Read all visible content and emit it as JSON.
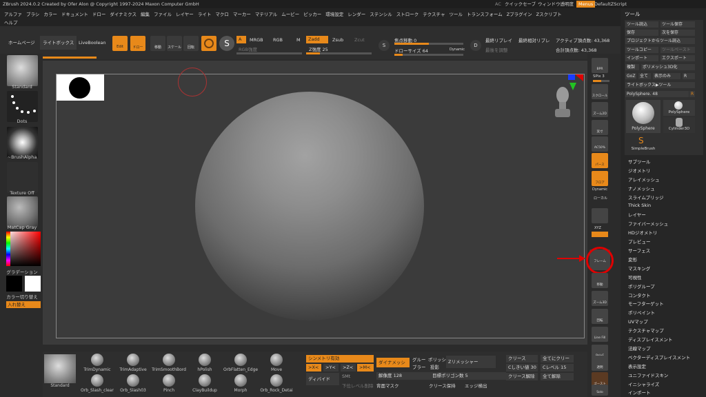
{
  "title": {
    "app": "ZBrush 2024.0.2  Created by Ofer Alon @ Copyright 1997-2024 Maxon Computer GmbH",
    "ac": "AC",
    "quicksave": "クイックセーブ",
    "window_transparency": "ウィンドウ透明度",
    "menus": "Menus",
    "script": "DefaultZScript"
  },
  "menubar": {
    "row1": [
      "アルファ",
      "ブラシ",
      "カラー",
      "ドキュメント",
      "ドロー",
      "ダイナミクス",
      "編集",
      "ファイル",
      "レイヤー",
      "ライト",
      "マクロ",
      "マーカー",
      "マテリアル",
      "ムービー",
      "ピッカー",
      "環境設定",
      "レンダー",
      "ステンシル",
      "ストローク",
      "テクスチャ",
      "ツール",
      "トランスフォーム",
      "Zプラグイン",
      "Zスクリプト"
    ],
    "row2": [
      "ヘルプ"
    ]
  },
  "tabs": {
    "home": "ホームページ",
    "lightbox": "ライトボックス",
    "liveboolean": "LiveBoolean"
  },
  "modes": {
    "edit": "Edit",
    "draw": "ドロー",
    "move": "移動",
    "scale": "スケール",
    "rotate": "回転"
  },
  "material_ops": {
    "a": "A",
    "mrgb": "MRGB",
    "rgb": "RGB",
    "m": "M",
    "rgb_intensity": "RGB強度"
  },
  "z_ops": {
    "zadd": "Zadd",
    "zsub": "Zsub",
    "zcut": "Zcut",
    "zintensity_label": "Z強度",
    "zintensity": "25"
  },
  "focal": {
    "label": "焦点移動",
    "value": "0",
    "drawsize_label": "ドローサイズ",
    "drawsize": "64",
    "dynamic": "Dynamic"
  },
  "replay": {
    "last": "最終リプレイ",
    "last_relative": "最終相対リプレ",
    "adjust": "最後を調整"
  },
  "points": {
    "active": "アクティブ頂点数: 43,368",
    "total": "合計頂点数: 43,368"
  },
  "left": {
    "brush": "Standard",
    "stroke": "Dots",
    "alpha": "~BrushAlpha",
    "texture": "Texture Off",
    "material": "MatCap Gray",
    "gradient": "グラデーション",
    "switch_color": "カラー切り替え",
    "swap": "入れ替え"
  },
  "right_shelf": {
    "bpr": "BPR",
    "spix_label": "SPix",
    "spix": "3",
    "scroll": "スクロール",
    "zoom2d": "ズーム2D",
    "actual": "実寸",
    "ac50": "AC50%",
    "perspective": "パース",
    "floor": "フロア",
    "dynamic": "Dynamic",
    "local": "ローカル",
    "xyz": "XYZ",
    "frame": "フレーム",
    "move": "移動",
    "zoom3d": "ズーム3D",
    "rotate": "回転",
    "linefill": "Line Fill",
    "polyf": "PolyF",
    "transp": "透明",
    "ghost": "ゴースト",
    "solo": "Solo"
  },
  "tool_panel": {
    "title": "ツール",
    "buttons": {
      "load": "ツール読込",
      "save_tool": "ツール保存",
      "save": "保存",
      "save_as": "次を保存",
      "load_from_project": "プロジェクトからツール読込",
      "copy": "ツールコピー",
      "paste": "ツールペースト",
      "import": "インポート",
      "export": "エクスポート",
      "clone": "複製",
      "make_polymesh": "ポリメッシュ3D化",
      "goz": "GoZ",
      "all": "全て",
      "visible": "表示のみ",
      "r": "R",
      "lightbox_tool": "ライトボックス▶ツール"
    },
    "current": "PolySphere. 48",
    "current_r": "R",
    "thumbs": {
      "polysphere": "PolySphere",
      "polysphere_small": "PolySphere",
      "cylinder": "Cylinder3D",
      "simplebrush": "SimpleBrush"
    },
    "subpalettes": [
      "サブツール",
      "ジオメトリ",
      "アレイメッシュ",
      "ナノメッシュ",
      "スライムブリッジ",
      "Thick Skin",
      "レイヤー",
      "ファイバーメッシュ",
      "HDジオメトリ",
      "プレビュー",
      "サーフェス",
      "変形",
      "マスキング",
      "可視性",
      "ポリグループ",
      "コンタクト",
      "モーフターゲット",
      "ポリペイント",
      "UVマップ",
      "テクスチャマップ",
      "ディスプレイスメント",
      "法線マップ",
      "ベクターディスプレイスメント",
      "表示設定",
      "ユニファイドスキン",
      "イニシャライズ",
      "インポート"
    ]
  },
  "bottom": {
    "brushes": [
      {
        "top": "TrimDynamic",
        "bottom": "Orb_Slash_clear"
      },
      {
        "top": "TrimAdaptive",
        "bottom": "Orb_Slash03"
      },
      {
        "top": "TrimSmoothBord",
        "bottom": "Pinch"
      },
      {
        "top": "hPolish",
        "bottom": "ClayBuildup"
      },
      {
        "top": "OrbFlatten_Edge",
        "bottom": "Morph"
      },
      {
        "top": "Move",
        "bottom": "Orb_Rock_Detai"
      }
    ],
    "current_brush": "Standard",
    "symmetry": "シンメトリ有効",
    "sym_x": ">X<",
    "sym_y": ">Y<",
    "sym_z": ">Z<",
    "sym_m": ">M<",
    "divide": "ディバイド",
    "lower_subdiv": "下位レベル削除",
    "smt": "SMt",
    "dynamesh": "ダイナメッシュ",
    "resolution_label": "解像度",
    "resolution": "128",
    "group": "グルー",
    "polish": "ポリッシ",
    "project": "投影",
    "blur": "ブラー",
    "back_mask": "背面マスク",
    "zremesher": "Zリメッシャー",
    "target_polys_label": "目標ポリゴン数",
    "target_polys": "5",
    "crease_keep": "クリース保持",
    "edge_detect": "エッジ検出",
    "crease": "クリース",
    "crease_all": "全てにクリース",
    "crease_lvl_label": "Cしきい値",
    "crease_lvl": "30",
    "c_level_label": "Cレベル",
    "c_level": "15",
    "uncrease": "クリース解除",
    "uncrease_all": "全て解除"
  }
}
